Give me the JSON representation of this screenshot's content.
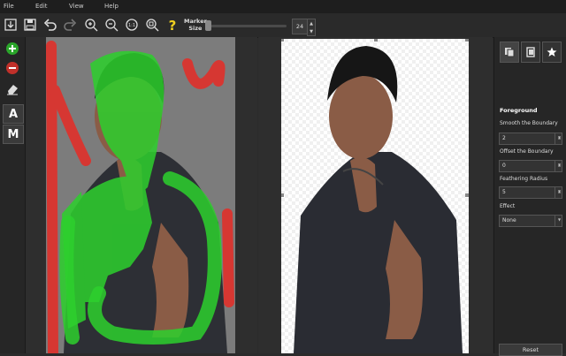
{
  "menu": {
    "file": "File",
    "edit": "Edit",
    "view": "View",
    "help": "Help"
  },
  "toolbar": {
    "marker_size_label_1": "Marker",
    "marker_size_label_2": "Size",
    "marker_size_value": "24",
    "marker_size_fraction": 0.05,
    "icons": [
      "open-icon",
      "save-icon",
      "undo-icon",
      "redo-icon",
      "zoom-in-icon",
      "zoom-out-icon",
      "zoom-fit-icon",
      "zoom-actual-icon",
      "help-icon"
    ]
  },
  "left_tools": {
    "add_marker": "add-foreground-icon",
    "remove_marker": "remove-background-icon",
    "eraser": "eraser-icon",
    "auto_label": "A",
    "manual_label": "M"
  },
  "right_panel": {
    "tabs": [
      "copy-icon",
      "paste-icon",
      "star-icon"
    ],
    "section_title": "Foreground",
    "smooth_label": "Smooth the Boundary",
    "smooth_value": "2",
    "offset_label": "Offset the Boundary",
    "offset_value": "0",
    "feather_label": "Feathering Radius",
    "feather_value": "5",
    "effect_label": "Effect",
    "effect_value": "None",
    "reset_label": "Reset"
  },
  "colors": {
    "foreground_marker": "#2dd02d",
    "background_marker": "#e0302a",
    "accent_add": "#2aa52a",
    "accent_remove": "#c0302a"
  }
}
